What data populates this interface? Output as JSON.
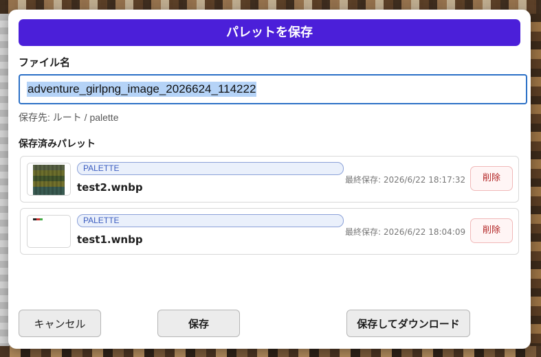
{
  "dialog": {
    "title": "パレットを保存",
    "filename_label": "ファイル名",
    "filename_value": "adventure_girlpng_image_2026624_114222",
    "save_destination": "保存先: ルート / palette",
    "saved_palettes_label": "保存済みパレット"
  },
  "saved_palettes": [
    {
      "badge": "PALETTE",
      "name": "test2.wnbp",
      "last_saved": "最終保存: 2026/6/22 18:17:32",
      "delete_label": "削除"
    },
    {
      "badge": "PALETTE",
      "name": "test1.wnbp",
      "last_saved": "最終保存: 2026/6/22 18:04:09",
      "delete_label": "削除"
    }
  ],
  "buttons": {
    "cancel": "キャンセル",
    "save": "保存",
    "save_download": "保存してダウンロード"
  },
  "colors": {
    "title_bar": "#4b1fd9",
    "input_border": "#2a6fc6",
    "badge_text": "#3a5bbf",
    "delete_text": "#b22424"
  }
}
